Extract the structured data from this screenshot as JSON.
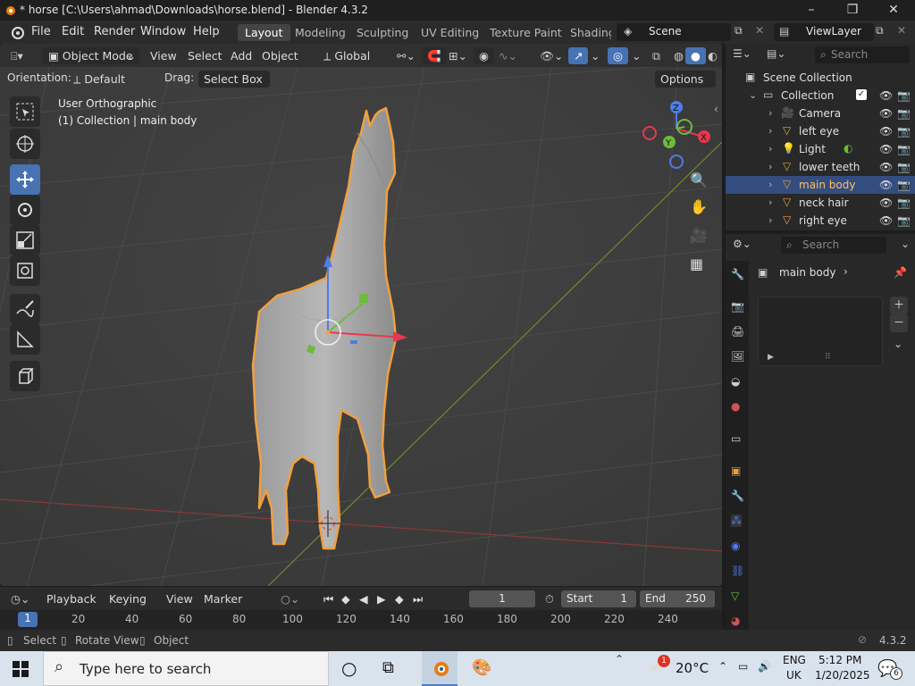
{
  "window": {
    "title": "* horse [C:\\Users\\ahmad\\Downloads\\horse.blend] - Blender 4.3.2",
    "minimize_icon": "minimize-icon",
    "maximize_icon": "restore-icon",
    "close_icon": "close-icon"
  },
  "menu": {
    "file": "File",
    "edit": "Edit",
    "render": "Render",
    "window": "Window",
    "help": "Help"
  },
  "workspaces": [
    "Layout",
    "Modeling",
    "Sculpting",
    "UV Editing",
    "Texture Paint",
    "Shading"
  ],
  "scene": {
    "label": "Scene",
    "viewlayer": "ViewLayer"
  },
  "viewport_header": {
    "mode": "Object Mode",
    "view": "View",
    "select": "Select",
    "add": "Add",
    "object": "Object",
    "transform": "Global"
  },
  "viewport_header2": {
    "orientation_label": "Orientation:",
    "orientation_value": "Default",
    "drag_label": "Drag:",
    "drag_value": "Select Box",
    "options": "Options"
  },
  "viewport": {
    "view_name": "User Orthographic",
    "context": "(1) Collection | main body",
    "gizmo": {
      "x": "X",
      "y": "Y",
      "z": "Z"
    }
  },
  "outliner": {
    "search_placeholder": "Search",
    "root": "Scene Collection",
    "collection": "Collection",
    "items": [
      {
        "name": "Camera",
        "icon": "camera-icon"
      },
      {
        "name": "left eye",
        "icon": "mesh-icon"
      },
      {
        "name": "Light",
        "icon": "light-icon"
      },
      {
        "name": "lower teeth",
        "icon": "mesh-icon"
      },
      {
        "name": "main body",
        "icon": "mesh-icon",
        "selected": true
      },
      {
        "name": "neck hair",
        "icon": "mesh-icon"
      },
      {
        "name": "right eye",
        "icon": "mesh-icon"
      }
    ]
  },
  "properties": {
    "search_placeholder": "Search",
    "object_name": "main body"
  },
  "timeline": {
    "playback": "Playback",
    "keying": "Keying",
    "view": "View",
    "marker": "Marker",
    "current_frame": "1",
    "start_label": "Start",
    "start": "1",
    "end_label": "End",
    "end": "250",
    "ruler": [
      "1",
      "20",
      "40",
      "60",
      "80",
      "100",
      "120",
      "140",
      "160",
      "180",
      "200",
      "220",
      "240"
    ]
  },
  "status": {
    "select": "Select",
    "rotate": "Rotate View",
    "object": "Object",
    "version": "4.3.2"
  },
  "taskbar": {
    "search_placeholder": "Type here to search",
    "weather_temp": "20°C",
    "weather_badge": "1",
    "lang": "ENG",
    "region": "UK",
    "time": "5:12 PM",
    "date": "1/20/2025",
    "notifications": "6"
  },
  "colors": {
    "accent": "#4772b3",
    "selection": "#334d80",
    "outline": "#f0a040"
  }
}
